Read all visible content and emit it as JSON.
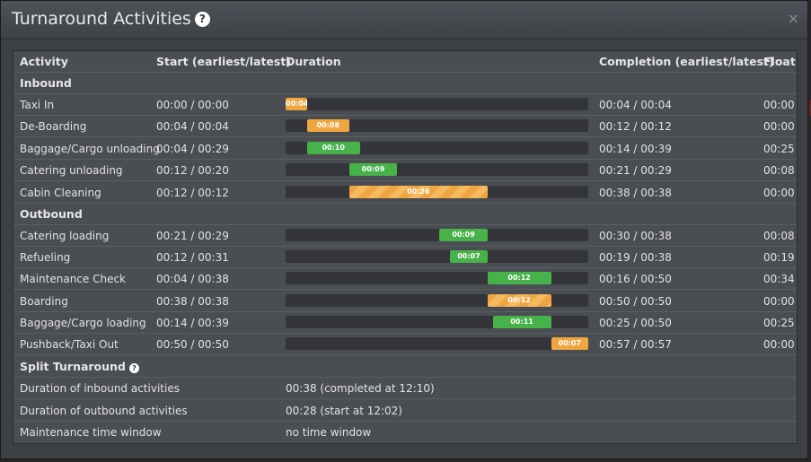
{
  "window": {
    "title": "Turnaround Activities",
    "help_icon": "?",
    "close_icon": "×"
  },
  "columns": {
    "activity": "Activity",
    "start": "Start (earliest/latest)",
    "duration": "Duration",
    "completion": "Completion (earliest/latest)",
    "float": "Float"
  },
  "colors": {
    "non_critical": "#47b14a",
    "critical": "#f0a640"
  },
  "timeline": {
    "max_minutes": 57
  },
  "groups": {
    "inbound": "Inbound",
    "outbound": "Outbound",
    "split": "Split Turnaround"
  },
  "activities": [
    {
      "name": "Taxi In",
      "start": "00:00 / 00:00",
      "offset": 0,
      "minutes": 4,
      "duration": "00:04",
      "completion": "00:04 / 00:04",
      "float": "00:00",
      "style": "orange"
    },
    {
      "name": "De-Boarding",
      "start": "00:04 / 00:04",
      "offset": 4,
      "minutes": 8,
      "duration": "00:08",
      "completion": "00:12 / 00:12",
      "float": "00:00",
      "style": "orange"
    },
    {
      "name": "Baggage/Cargo unloading",
      "start": "00:04 / 00:29",
      "offset": 4,
      "minutes": 10,
      "duration": "00:10",
      "completion": "00:14 / 00:39",
      "float": "00:25",
      "style": "green"
    },
    {
      "name": "Catering unloading",
      "start": "00:12 / 00:20",
      "offset": 12,
      "minutes": 9,
      "duration": "00:09",
      "completion": "00:21 / 00:29",
      "float": "00:08",
      "style": "green"
    },
    {
      "name": "Cabin Cleaning",
      "start": "00:12 / 00:12",
      "offset": 12,
      "minutes": 26,
      "duration": "00:26",
      "completion": "00:38 / 00:38",
      "float": "00:00",
      "style": "critical"
    },
    {
      "name": "Catering loading",
      "start": "00:21 / 00:29",
      "offset": 29,
      "minutes": 9,
      "duration": "00:09",
      "completion": "00:30 / 00:38",
      "float": "00:08",
      "style": "green"
    },
    {
      "name": "Refueling",
      "start": "00:12 / 00:31",
      "offset": 31,
      "minutes": 7,
      "duration": "00:07",
      "completion": "00:19 / 00:38",
      "float": "00:19",
      "style": "green"
    },
    {
      "name": "Maintenance Check",
      "start": "00:04 / 00:38",
      "offset": 38,
      "minutes": 12,
      "duration": "00:12",
      "completion": "00:16 / 00:50",
      "float": "00:34",
      "style": "green"
    },
    {
      "name": "Boarding",
      "start": "00:38 / 00:38",
      "offset": 38,
      "minutes": 12,
      "duration": "00:12",
      "completion": "00:50 / 00:50",
      "float": "00:00",
      "style": "critical"
    },
    {
      "name": "Baggage/Cargo loading",
      "start": "00:14 / 00:39",
      "offset": 39,
      "minutes": 11,
      "duration": "00:11",
      "completion": "00:25 / 00:50",
      "float": "00:25",
      "style": "green"
    },
    {
      "name": "Pushback/Taxi Out",
      "start": "00:50 / 00:50",
      "offset": 50,
      "minutes": 7,
      "duration": "00:07",
      "completion": "00:57 / 00:57",
      "float": "00:00",
      "style": "orange"
    }
  ],
  "split": {
    "help_icon": "?",
    "rows": [
      {
        "label": "Duration of inbound activities",
        "value": "00:38 (completed at 12:10)"
      },
      {
        "label": "Duration of outbound activities",
        "value": "00:28 (start at 12:02)"
      },
      {
        "label": "Maintenance time window",
        "value": "no time window"
      }
    ]
  }
}
